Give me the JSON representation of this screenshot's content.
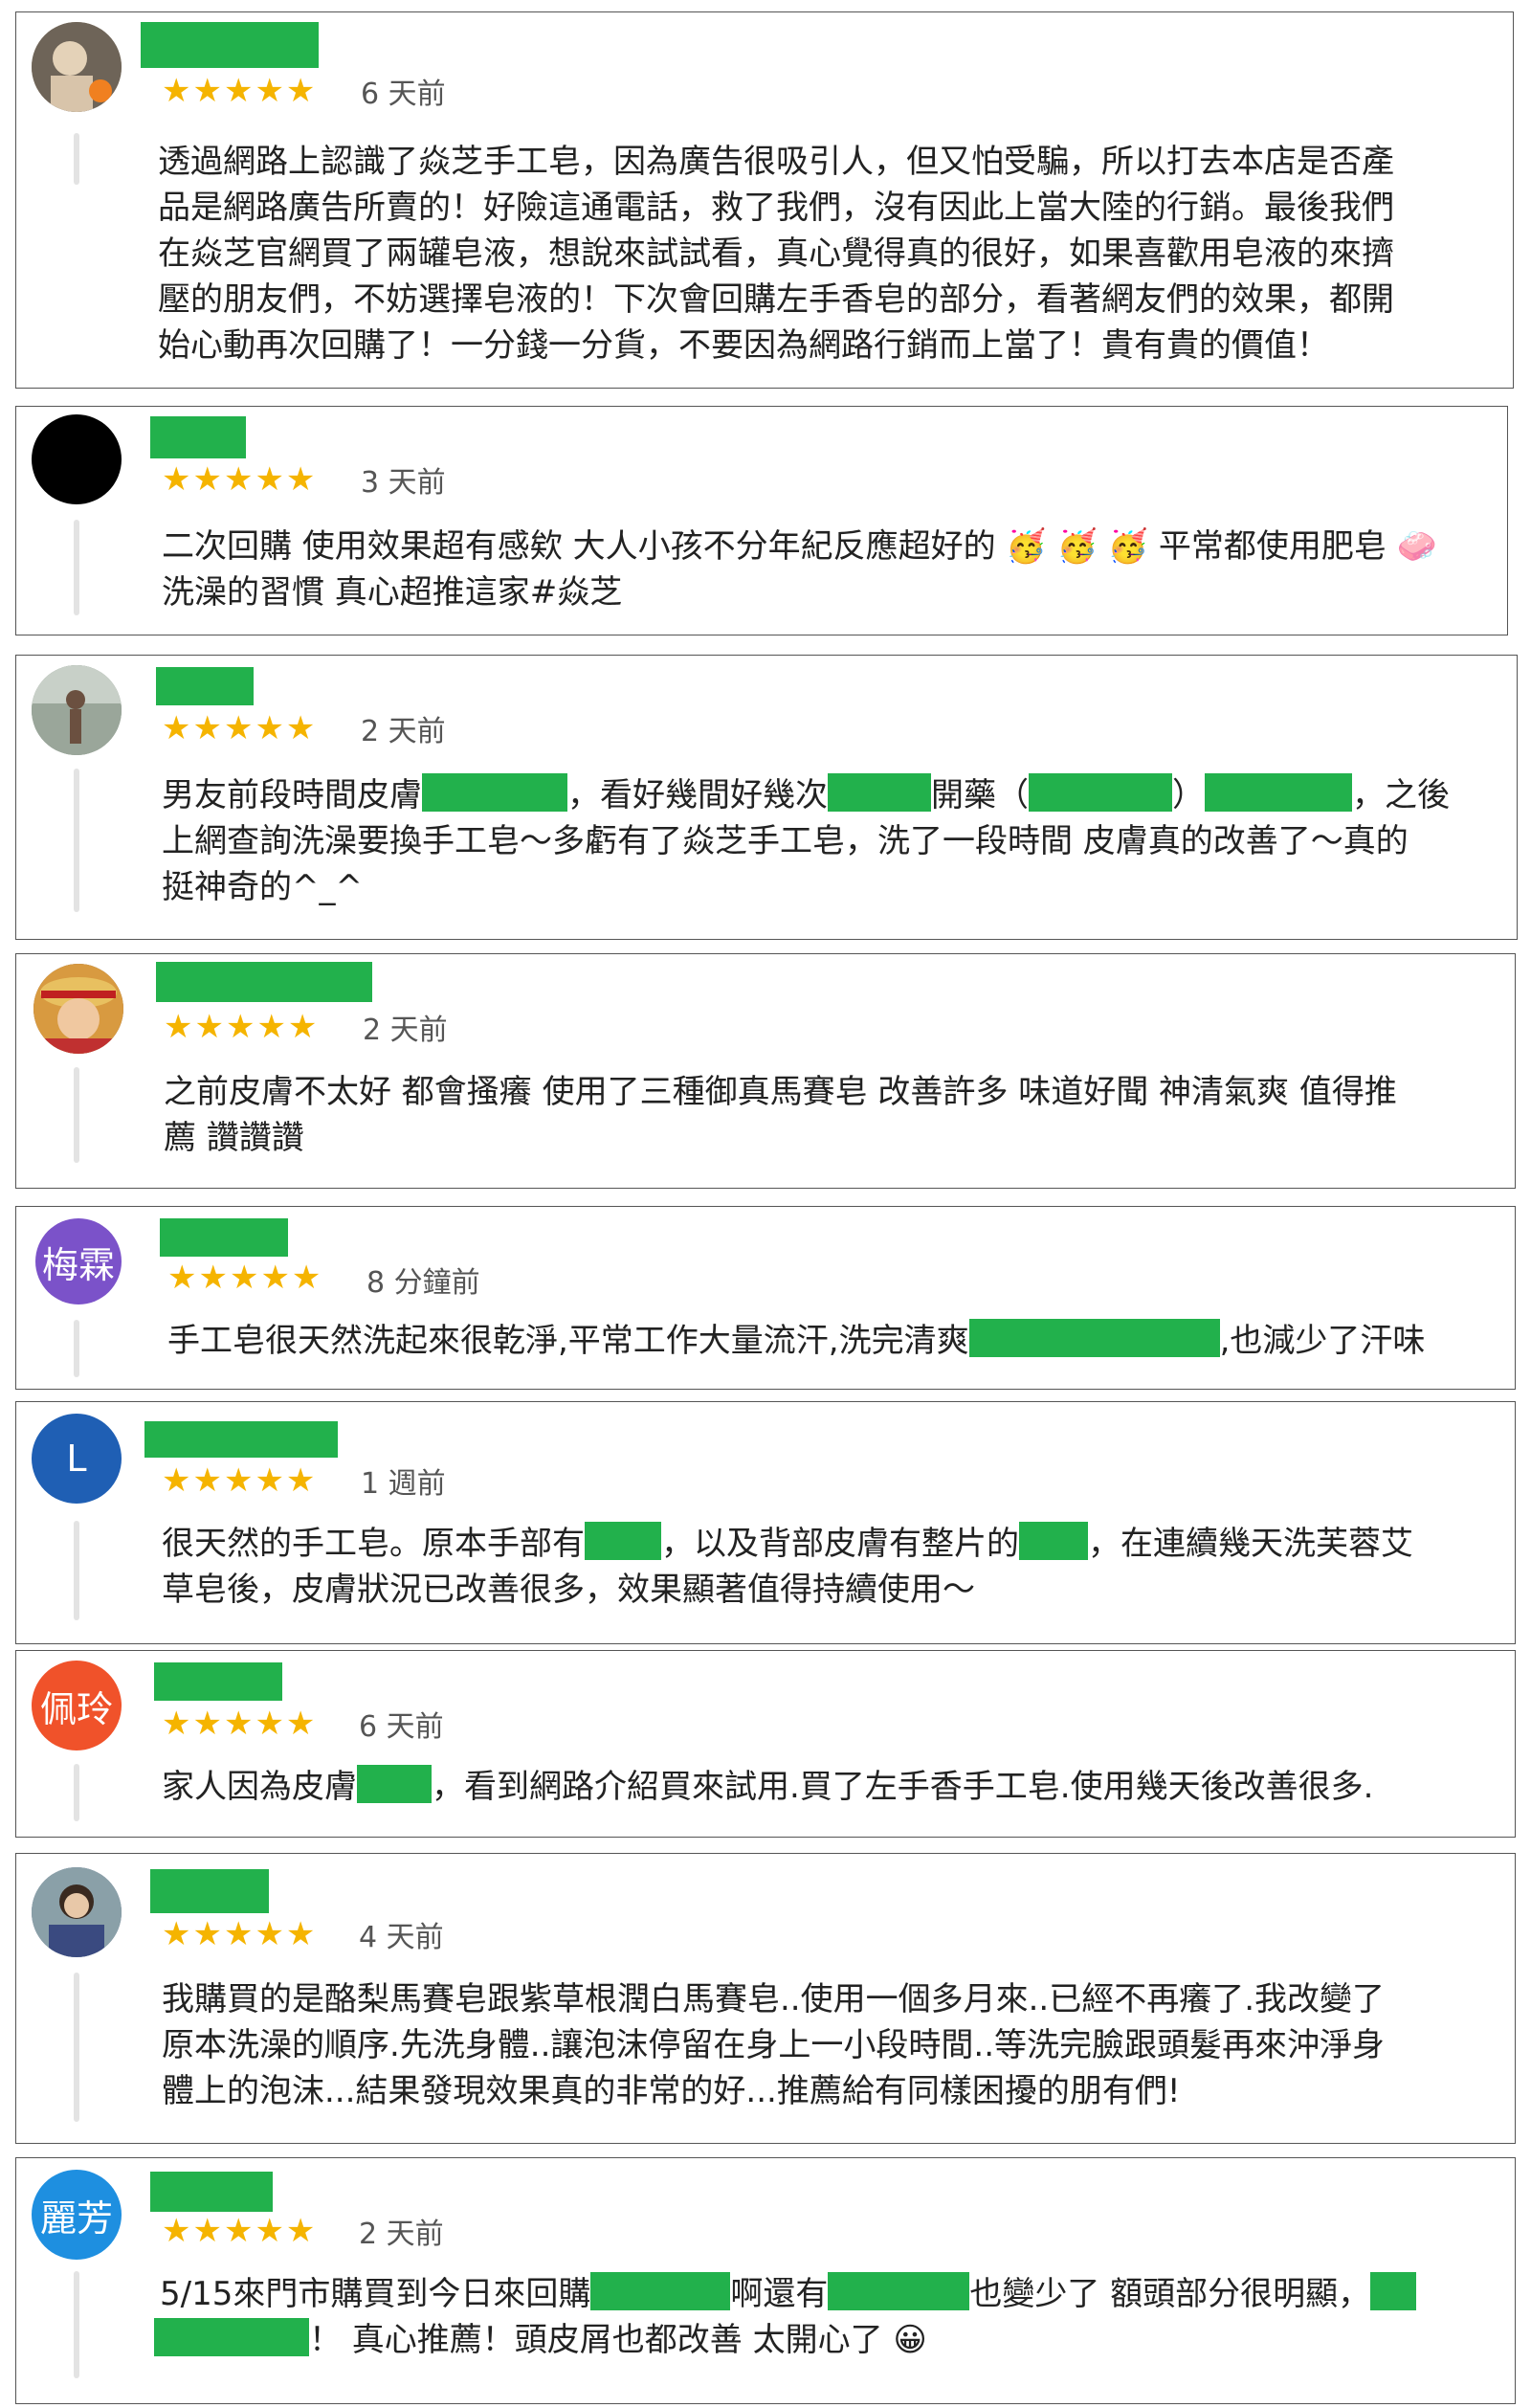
{
  "reviews": [
    {
      "avatar": {
        "type": "photo",
        "colors": [
          "#8a7a6a",
          "#d8c4aa"
        ]
      },
      "stars": "★★★★★",
      "time": "6 天前",
      "lines": [
        "透過網路上認識了焱芝手工皂，因為廣告很吸引人，但又怕受騙，所以打去本店是否產",
        "品是網路廣告所賣的！好險這通電話，救了我們，沒有因此上當大陸的行銷。最後我們",
        "在焱芝官網買了兩罐皂液，想說來試試看，真心覺得真的很好，如果喜歡用皂液的來擠",
        "壓的朋友們，不妨選擇皂液的！下次會回購左手香皂的部分，看著網友們的效果，都開",
        "始心動再次回購了！一分錢一分貨，不要因為網路行銷而上當了！貴有貴的價值！"
      ]
    },
    {
      "avatar": {
        "type": "solid",
        "colors": [
          "#000000"
        ]
      },
      "stars": "★★★★★",
      "time": "3 天前",
      "lines": [
        "二次回購 使用效果超有感欸 大人小孩不分年紀反應超好的 🥳 🥳 🥳 平常都使用肥皂 🧼",
        "洗澡的習慣 真心超推這家#焱芝"
      ]
    },
    {
      "avatar": {
        "type": "photo",
        "colors": [
          "#6b7a6a",
          "#c8d0c8"
        ]
      },
      "stars": "★★★★★",
      "time": "2 天前",
      "line1": [
        "男友前段時間皮膚",
        "，看好幾間好幾次",
        "開藥（",
        "）",
        "，之後"
      ],
      "lines": [
        "上網查詢洗澡要換手工皂～多虧有了焱芝手工皂，洗了一段時間 皮膚真的改善了～真的",
        "挺神奇的^_^"
      ]
    },
    {
      "avatar": {
        "type": "photo",
        "colors": [
          "#7a4a20",
          "#e0a040"
        ]
      },
      "stars": "★★★★★",
      "time": "2 天前",
      "lines": [
        "之前皮膚不太好 都會搔癢 使用了三種御真馬賽皂 改善許多 味道好聞 神清氣爽 值得推",
        "薦 讚讚讚"
      ]
    },
    {
      "avatar": {
        "type": "initial",
        "text": "梅霖",
        "colors": [
          "#7b52c9"
        ]
      },
      "stars": "★★★★★",
      "time": "8 分鐘前",
      "line1": [
        "手工皂很天然洗起來很乾淨,平常工作大量流汗,洗完清爽",
        ",也減少了汗味"
      ]
    },
    {
      "avatar": {
        "type": "initial",
        "text": "L",
        "colors": [
          "#1f5fb4"
        ]
      },
      "stars": "★★★★★",
      "time": "1 週前",
      "line1": [
        "很天然的手工皂。原本手部有",
        "，以及背部皮膚有整片的",
        "，在連續幾天洗芙蓉艾"
      ],
      "lines": [
        "草皂後，皮膚狀況已改善很多，效果顯著值得持續使用～"
      ]
    },
    {
      "avatar": {
        "type": "initial",
        "text": "佩玲",
        "colors": [
          "#f0522a"
        ]
      },
      "stars": "★★★★★",
      "time": "6 天前",
      "line1": [
        "家人因為皮膚",
        "，看到網路介紹買來試用.買了左手香手工皂.使用幾天後改善很多."
      ]
    },
    {
      "avatar": {
        "type": "photo",
        "colors": [
          "#4a5a7a",
          "#c0a890"
        ]
      },
      "stars": "★★★★★",
      "time": "4 天前",
      "lines": [
        "我購買的是酪梨馬賽皂跟紫草根潤白馬賽皂..使用一個多月來..已經不再癢了.我改變了",
        "原本洗澡的順序.先洗身體..讓泡沫停留在身上一小段時間..等洗完臉跟頭髮再來沖淨身",
        "體上的泡沫...結果發現效果真的非常的好...推薦給有同樣困擾的朋有們!"
      ]
    },
    {
      "avatar": {
        "type": "initial",
        "text": "麗芳",
        "colors": [
          "#1e8fe0"
        ]
      },
      "stars": "★★★★★",
      "time": "2 天前",
      "line1": [
        "5/15來門市購買到今日來回購",
        "啊還有",
        "也變少了 額頭部分很明顯，"
      ],
      "line2": [
        "！ 真心推薦！頭皮屑也都改善 太開心了 😀"
      ]
    }
  ]
}
